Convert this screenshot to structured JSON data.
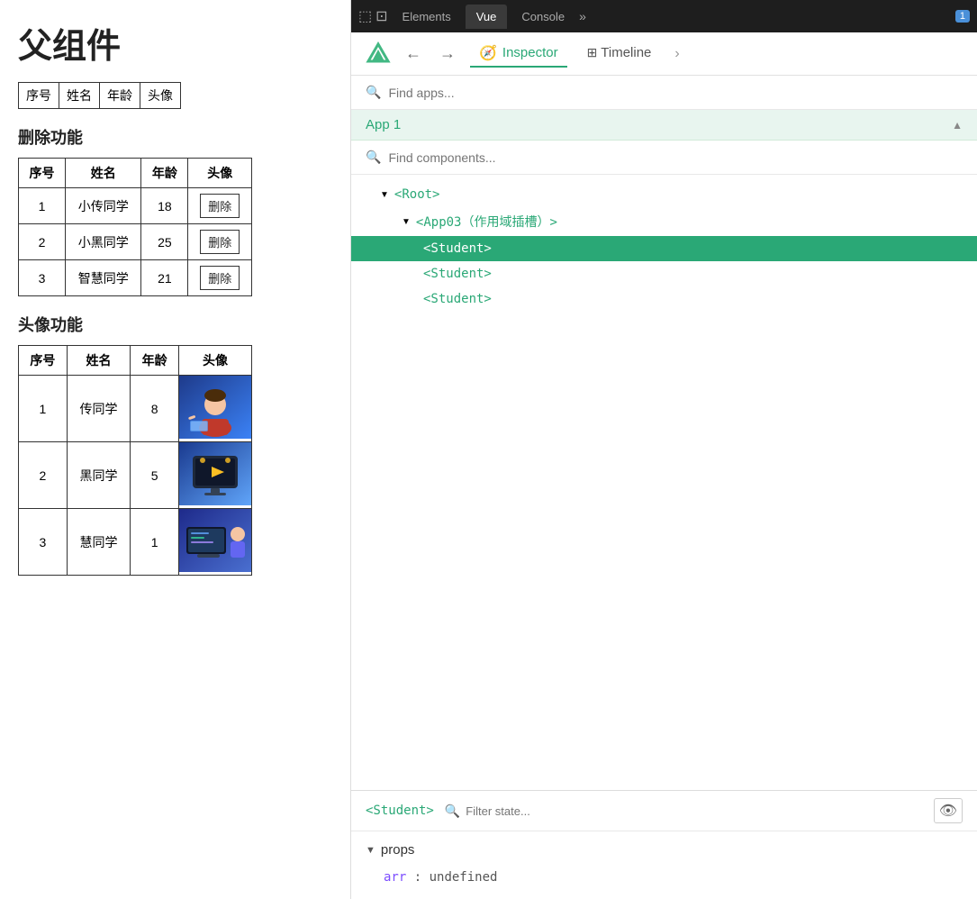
{
  "left": {
    "title": "父组件",
    "simple_table_headers": [
      "序号",
      "姓名",
      "年龄",
      "头像"
    ],
    "delete_section_title": "删除功能",
    "delete_table": {
      "headers": [
        "序号",
        "姓名",
        "年龄",
        "头像"
      ],
      "rows": [
        {
          "id": "1",
          "name": "小传同学",
          "age": "18",
          "action": "删除"
        },
        {
          "id": "2",
          "name": "小黑同学",
          "age": "25",
          "action": "删除"
        },
        {
          "id": "3",
          "name": "智慧同学",
          "age": "21",
          "action": "删除"
        }
      ]
    },
    "avatar_section_title": "头像功能",
    "avatar_table": {
      "headers": [
        "序号",
        "姓名",
        "年龄",
        "头像"
      ],
      "rows": [
        {
          "id": "1",
          "name": "传同学",
          "age": "8"
        },
        {
          "id": "2",
          "name": "黑同学",
          "age": "5"
        },
        {
          "id": "3",
          "name": "慧同学",
          "age": "1"
        }
      ]
    }
  },
  "devtools": {
    "topbar_tabs": [
      "Elements",
      "Vue",
      "Console"
    ],
    "active_tab": "Vue",
    "badge": "1",
    "vue_header": {
      "back_arrow": "←",
      "forward_arrow": "→",
      "inspector_label": "Inspector",
      "timeline_label": "Timeline"
    },
    "find_apps_placeholder": "Find apps...",
    "app1_label": "App 1",
    "find_components_placeholder": "Find components...",
    "tree": {
      "items": [
        {
          "label": "<Root>",
          "indent": 2,
          "arrow": "▼",
          "selected": false
        },
        {
          "label": "<App03（作用域插槽）>",
          "indent": 3,
          "arrow": "▼",
          "selected": false
        },
        {
          "label": "<Student>",
          "indent": 4,
          "arrow": "",
          "selected": true
        },
        {
          "label": "<Student>",
          "indent": 4,
          "arrow": "",
          "selected": false
        },
        {
          "label": "<Student>",
          "indent": 4,
          "arrow": "",
          "selected": false
        }
      ]
    },
    "bottom": {
      "component_label": "<Student>",
      "filter_placeholder": "Filter state...",
      "props_label": "props",
      "props": [
        {
          "key": "arr",
          "colon": ":",
          "value": "undefined"
        }
      ]
    }
  }
}
